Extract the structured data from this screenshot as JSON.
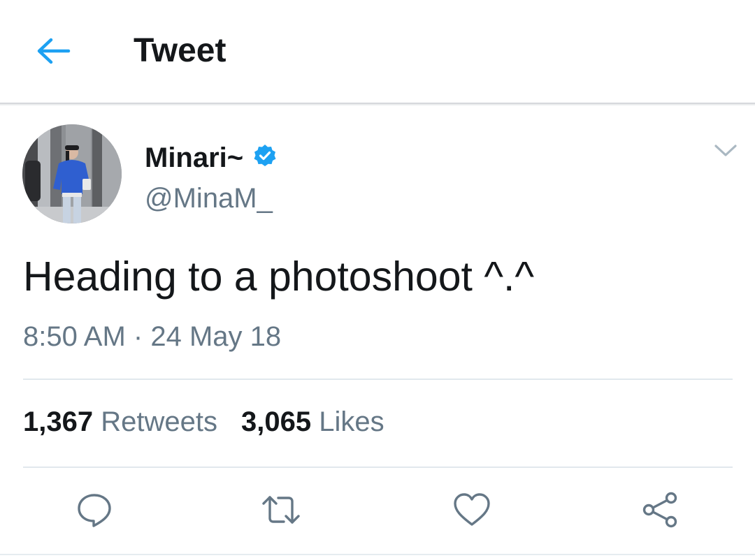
{
  "header": {
    "title": "Tweet",
    "back_icon": "arrow-left-icon",
    "accent_color": "#1da1f2"
  },
  "tweet": {
    "author": {
      "display_name": "Minari~",
      "handle": "@MinaM_",
      "verified": true,
      "verified_icon": "verified-badge-icon"
    },
    "text": "Heading to a photoshoot ^.^",
    "time": "8:50 AM",
    "separator": "·",
    "date": "24 May 18",
    "stats": {
      "retweets_count": "1,367",
      "retweets_label": "Retweets",
      "likes_count": "3,065",
      "likes_label": "Likes"
    },
    "menu_icon": "chevron-down-icon"
  },
  "actions": [
    {
      "name": "reply",
      "icon": "comment-icon"
    },
    {
      "name": "retweet",
      "icon": "retweet-icon"
    },
    {
      "name": "like",
      "icon": "heart-icon"
    },
    {
      "name": "share",
      "icon": "share-icon"
    }
  ],
  "colors": {
    "text_primary": "#14171a",
    "text_secondary": "#657786",
    "divider": "#e1e8ed",
    "verified": "#1da1f2"
  }
}
